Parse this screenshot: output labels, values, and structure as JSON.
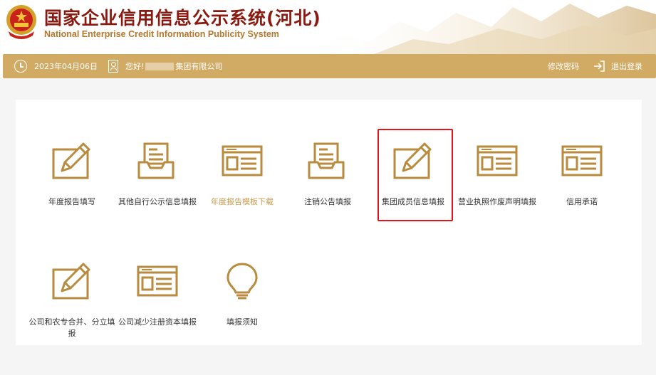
{
  "header": {
    "title_cn": "国家企业信用信息公示系统(河北)",
    "title_en": "National Enterprise Credit Information Publicity System",
    "emblem_icon": "national-emblem-icon"
  },
  "topbar": {
    "date": "2023年04月06日",
    "greeting": "您好!",
    "company_suffix": "集团有限公司",
    "change_password": "修改密码",
    "logout": "退出登录"
  },
  "colors": {
    "gold": "#d1aa64",
    "icon_gold": "#b98b3e",
    "highlight": "#e3141a",
    "title_red": "#8a1a10"
  },
  "tiles": [
    {
      "label": "年度报告填写",
      "icon": "edit-pen-icon"
    },
    {
      "label": "其他自行公示信息填报",
      "icon": "inbox-tray-icon"
    },
    {
      "label": "年度报告模板下载",
      "icon": "form-window-icon",
      "active": true
    },
    {
      "label": "注销公告填报",
      "icon": "inbox-tray-icon"
    },
    {
      "label": "集团成员信息填报",
      "icon": "edit-pen-icon"
    },
    {
      "label": "营业执照作废声明填报",
      "icon": "form-window-icon"
    },
    {
      "label": "信用承诺",
      "icon": "form-window-icon"
    },
    {
      "label": "公司和农专合并、分立填报",
      "icon": "edit-pen-icon"
    },
    {
      "label": "公司减少注册资本填报",
      "icon": "form-window-icon"
    },
    {
      "label": "填报须知",
      "icon": "lightbulb-icon"
    }
  ]
}
